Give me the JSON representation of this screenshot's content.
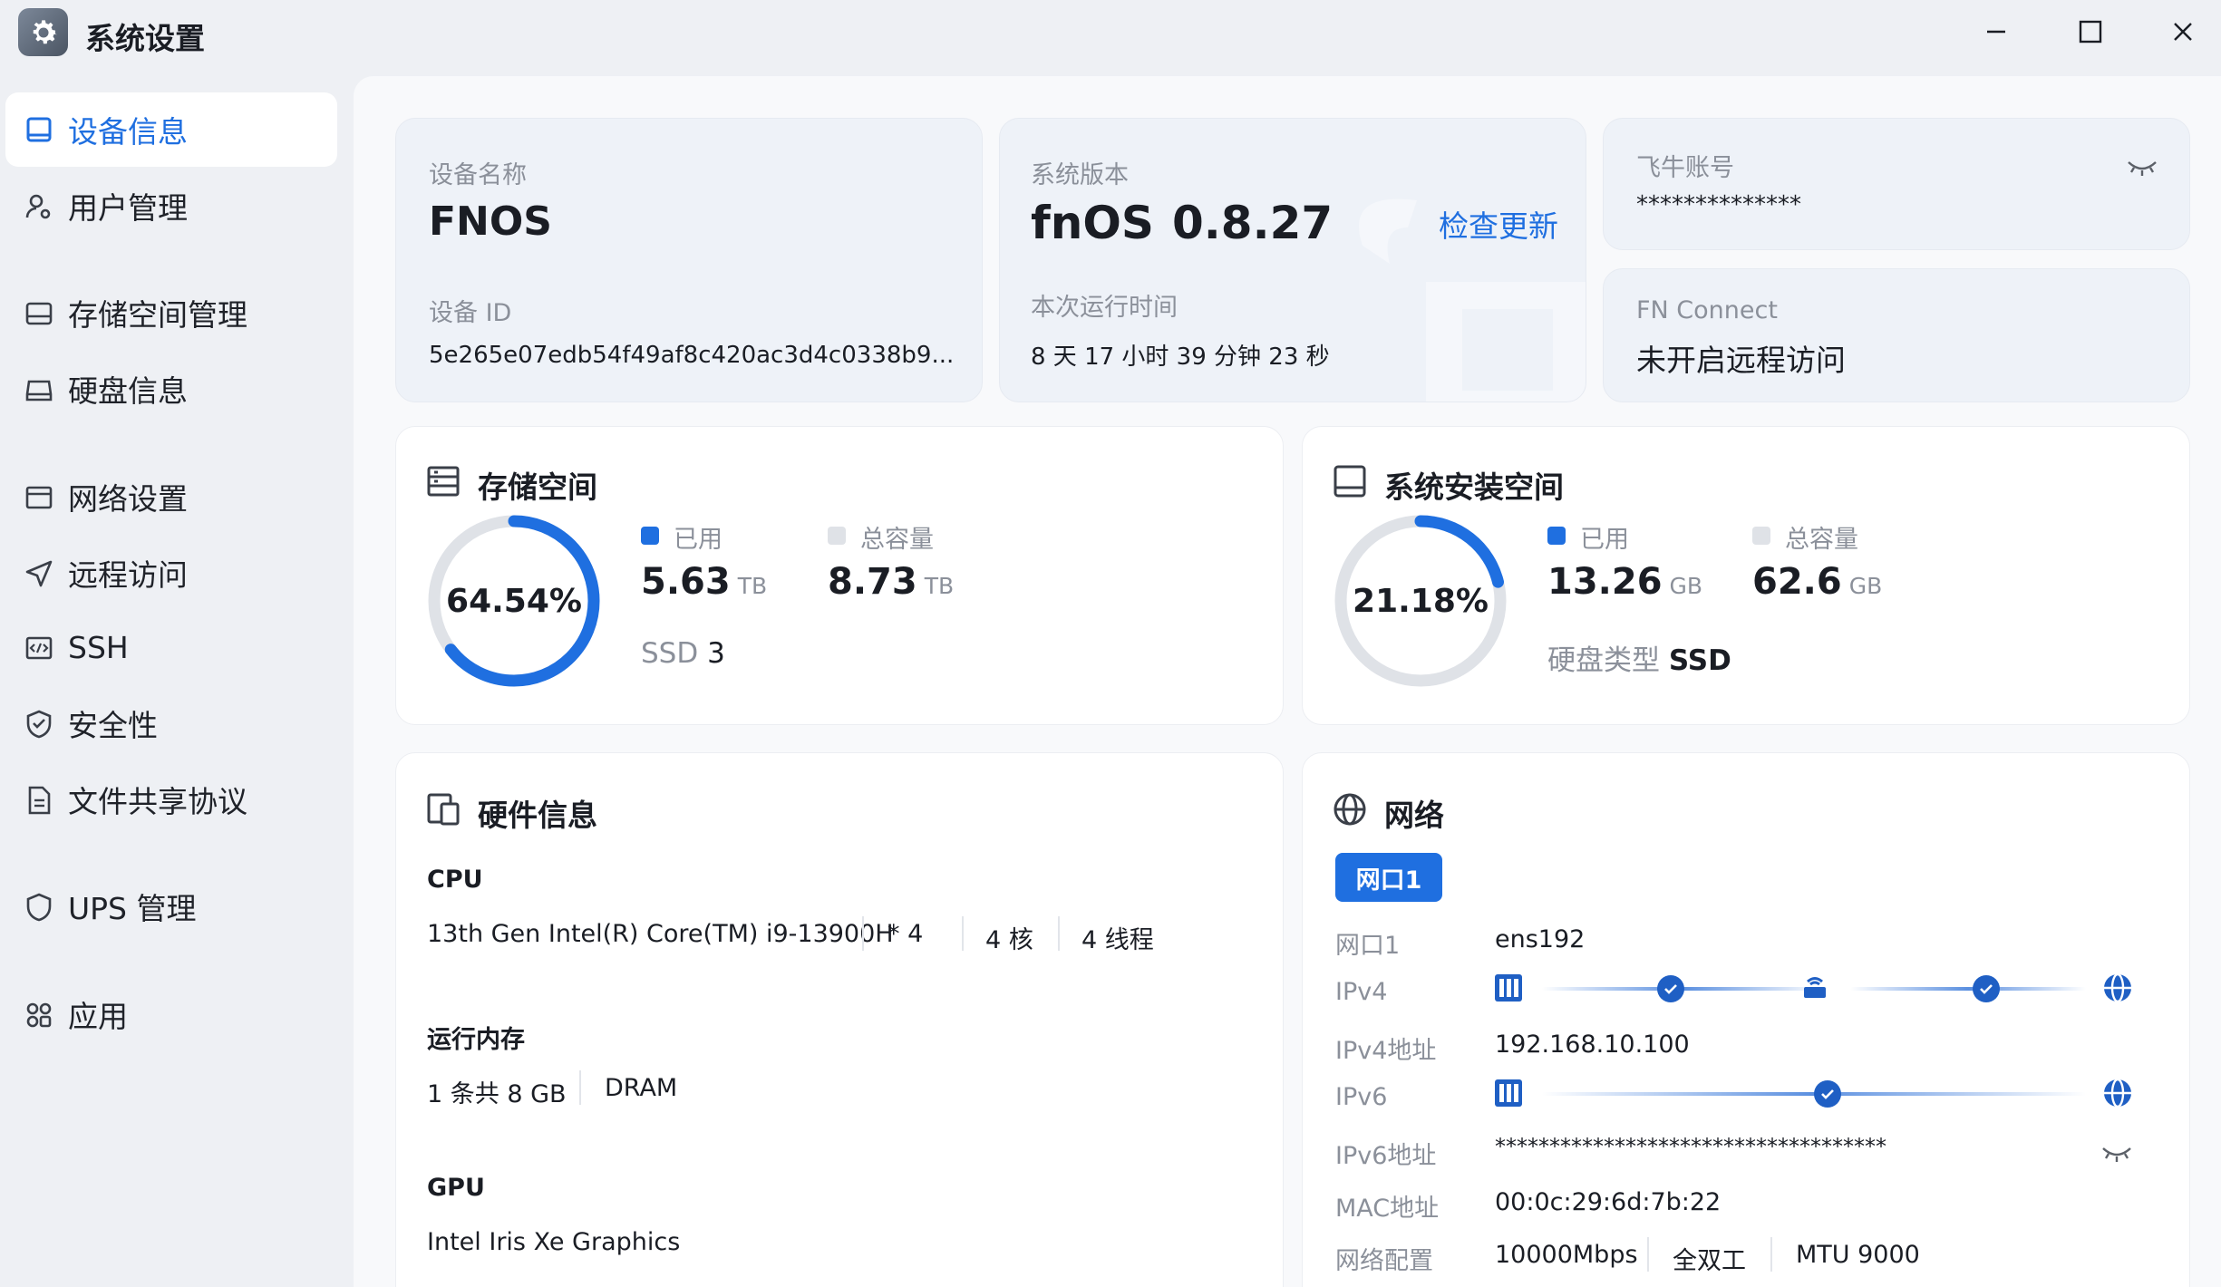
{
  "window": {
    "title": "系统设置",
    "buttons": {
      "minimize": "minimize-icon",
      "maximize": "maximize-icon",
      "close": "close-icon"
    }
  },
  "colors": {
    "accent": "#1f6fe0",
    "track": "#dfe2e7",
    "page_bg": "#f8f9fb",
    "sidebar_bg": "#eef0f4"
  },
  "sidebar": {
    "items": [
      {
        "label": "设备信息",
        "icon": "monitor-icon",
        "active": true
      },
      {
        "label": "用户管理",
        "icon": "user-gear-icon"
      },
      {
        "label": "存储空间管理",
        "icon": "drive-icon"
      },
      {
        "label": "硬盘信息",
        "icon": "hard-disk-icon"
      },
      {
        "label": "网络设置",
        "icon": "window-icon"
      },
      {
        "label": "远程访问",
        "icon": "send-icon"
      },
      {
        "label": "SSH",
        "icon": "code-icon"
      },
      {
        "label": "安全性",
        "icon": "shield-check-icon"
      },
      {
        "label": "文件共享协议",
        "icon": "document-icon"
      },
      {
        "label": "UPS 管理",
        "icon": "shield-icon"
      },
      {
        "label": "应用",
        "icon": "apps-icon"
      }
    ]
  },
  "device": {
    "name_label": "设备名称",
    "name": "FNOS",
    "id_label": "设备 ID",
    "id": "5e265e07edb54f49af8c420ac3d4c0338b9..."
  },
  "system": {
    "version_label": "系统版本",
    "os": "fnOS",
    "version": "0.8.27",
    "check_update": "检查更新",
    "uptime_label": "本次运行时间",
    "uptime": "8 天 17 小时 39 分钟 23 秒"
  },
  "account": {
    "label": "飞牛账号",
    "value": "**************"
  },
  "fn_connect": {
    "label": "FN Connect",
    "value": "未开启远程访问"
  },
  "storage": {
    "title": "存储空间",
    "percent_text": "64.54%",
    "percent": 64.54,
    "used_label": "已用",
    "used": "5.63",
    "used_unit": "TB",
    "total_label": "总容量",
    "total": "8.73",
    "total_unit": "TB",
    "disk_type": "SSD",
    "disk_count": "3"
  },
  "sys_space": {
    "title": "系统安装空间",
    "percent_text": "21.18%",
    "percent": 21.18,
    "used_label": "已用",
    "used": "13.26",
    "used_unit": "GB",
    "total_label": "总容量",
    "total": "62.6",
    "total_unit": "GB",
    "disk_type_label": "硬盘类型",
    "disk_type": "SSD"
  },
  "hardware": {
    "title": "硬件信息",
    "cpu_label": "CPU",
    "cpu_model": "13th Gen Intel(R) Core(TM) i9-13900H",
    "cpu_count": "* 4",
    "cpu_cores": "4 核",
    "cpu_threads": "4 线程",
    "mem_label": "运行内存",
    "mem_size": "1 条共 8 GB",
    "mem_type": "DRAM",
    "gpu_label": "GPU",
    "gpu_model": "Intel Iris Xe Graphics"
  },
  "network": {
    "title": "网络",
    "tab": "网口1",
    "port_label": "网口1",
    "port": "ens192",
    "ipv4_label": "IPv4",
    "ipv4_addr_label": "IPv4地址",
    "ipv4_addr": "192.168.10.100",
    "ipv6_label": "IPv6",
    "ipv6_addr_label": "IPv6地址",
    "ipv6_addr": "************************************",
    "mac_label": "MAC地址",
    "mac": "00:0c:29:6d:7b:22",
    "config_label": "网络配置",
    "speed": "10000Mbps",
    "duplex": "全双工",
    "mtu": "MTU 9000"
  }
}
